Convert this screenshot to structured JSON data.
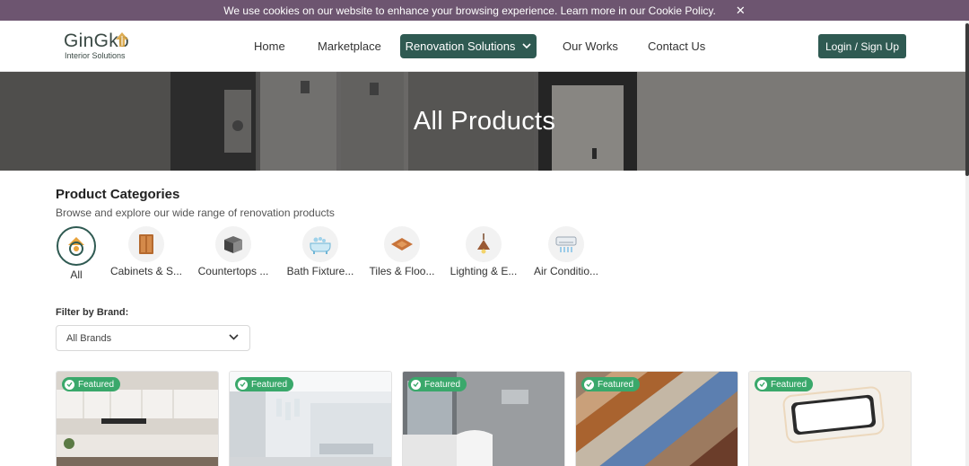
{
  "cookie": {
    "text": "We use cookies on our website to enhance your browsing experience. Learn more in our Cookie Policy.",
    "close": "✕"
  },
  "brand": {
    "name": "GinGko",
    "tagline": "Interior Solutions"
  },
  "nav": {
    "home": "Home",
    "marketplace": "Marketplace",
    "renovation": "Renovation Solutions",
    "works": "Our Works",
    "contact": "Contact Us",
    "login": "Login / Sign Up"
  },
  "hero": {
    "title": "All Products"
  },
  "categories": {
    "title": "Product Categories",
    "subtitle": "Browse and explore our wide range of renovation products",
    "items": [
      {
        "label": "All",
        "icon": "all-icon"
      },
      {
        "label": "Cabinets & S...",
        "icon": "cabinet-icon"
      },
      {
        "label": "Countertops ...",
        "icon": "countertop-icon"
      },
      {
        "label": "Bath Fixture...",
        "icon": "bathtub-icon"
      },
      {
        "label": "Tiles & Floo...",
        "icon": "tile-icon"
      },
      {
        "label": "Lighting & E...",
        "icon": "lamp-icon"
      },
      {
        "label": "Air Conditio...",
        "icon": "air-conditioner-icon"
      }
    ]
  },
  "filter": {
    "label": "Filter by Brand:",
    "selected": "All Brands"
  },
  "products": [
    {
      "badge": "Featured",
      "image": "kitchen"
    },
    {
      "badge": "Featured",
      "image": "living-room"
    },
    {
      "badge": "Featured",
      "image": "bathroom"
    },
    {
      "badge": "Featured",
      "image": "tiles"
    },
    {
      "badge": "Featured",
      "image": "ceiling-light"
    }
  ],
  "colors": {
    "primary": "#2f5a52",
    "cookie_bar": "#6d5570",
    "badge": "#3aa86b"
  }
}
